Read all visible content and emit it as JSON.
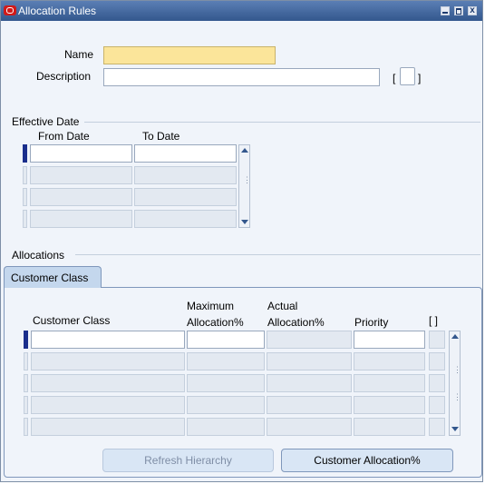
{
  "window": {
    "title": "Allocation Rules",
    "min_label": "",
    "max_label": "",
    "close_label": "x"
  },
  "header": {
    "name_label": "Name",
    "name_value": "",
    "description_label": "Description",
    "description_value": "",
    "bracket_open": "[",
    "bracket_close": "]"
  },
  "effective_date": {
    "section_label": "Effective Date",
    "columns": [
      "From Date",
      "To Date"
    ],
    "rows": [
      [
        "",
        ""
      ],
      [
        "",
        ""
      ],
      [
        "",
        ""
      ],
      [
        "",
        ""
      ]
    ]
  },
  "allocations": {
    "section_label": "Allocations",
    "tab_label": "Customer Class",
    "columns": {
      "customer_class": "Customer Class",
      "max_line1": "Maximum",
      "max_line2": "Allocation%",
      "actual_line1": "Actual",
      "actual_line2": "Allocation%",
      "priority": "Priority",
      "flex": "[ ]"
    },
    "rows": [
      [
        "",
        "",
        "",
        ""
      ],
      [
        "",
        "",
        "",
        ""
      ],
      [
        "",
        "",
        "",
        ""
      ],
      [
        "",
        "",
        "",
        ""
      ],
      [
        "",
        "",
        "",
        ""
      ]
    ]
  },
  "buttons": {
    "refresh_hierarchy": "Refresh Hierarchy",
    "customer_allocation": "Customer Allocation%"
  },
  "colors": {
    "required_field": "#fbe59a",
    "title_bar": "#33578d",
    "current_row": "#1a2e8c"
  }
}
